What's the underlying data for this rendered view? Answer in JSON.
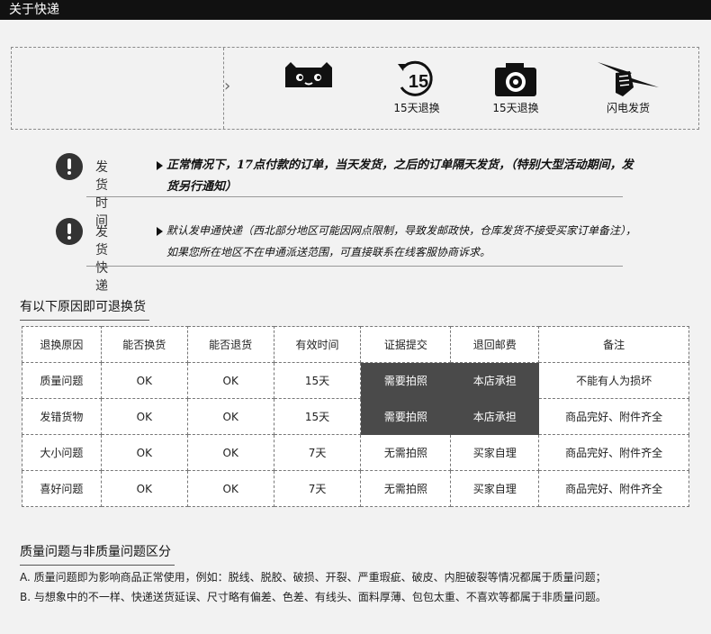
{
  "header": {
    "title": "关于快递"
  },
  "badges": [
    {
      "icon": "tmall-cat-icon",
      "label": ""
    },
    {
      "icon": "fifteen-day-return-icon",
      "label": "15天退换"
    },
    {
      "icon": "camera-icon",
      "label": "15天退换"
    },
    {
      "icon": "lightning-fist-icon",
      "label": "闪电发货"
    }
  ],
  "shipping_time": {
    "label": "发货时间",
    "line1": "正常情况下，17点付款的订单，当天发货，之后的订单隔天发货，（特别大型活动期间，发",
    "line2": "货另行通知）"
  },
  "shipping_courier": {
    "label": "发货快递",
    "line1": "默认发申通快递（西北部分地区可能因网点限制，导致发邮政快，仓库发货不接受买家订单备注），",
    "line2": "如果您所在地区不在申通派送范围，可直接联系在线客服协商诉求。"
  },
  "return_section": {
    "title": "有以下原因即可退换货",
    "headers": [
      "退换原因",
      "能否换货",
      "能否退货",
      "有效时间",
      "证据提交",
      "退回邮费",
      "备注"
    ],
    "rows": [
      [
        "质量问题",
        "OK",
        "OK",
        "15天",
        "需要拍照",
        "本店承担",
        "不能有人为损坏"
      ],
      [
        "发错货物",
        "OK",
        "OK",
        "15天",
        "需要拍照",
        "本店承担",
        "商品完好、附件齐全"
      ],
      [
        "大小问题",
        "OK",
        "OK",
        "7天",
        "无需拍照",
        "买家自理",
        "商品完好、附件齐全"
      ],
      [
        "喜好问题",
        "OK",
        "OK",
        "7天",
        "无需拍照",
        "买家自理",
        "商品完好、附件齐全"
      ]
    ]
  },
  "quality_section": {
    "title": "质量问题与非质量问题区分",
    "line_a": "A. 质量问题即为影响商品正常使用，例如：脱线、脱胶、破损、开裂、严重瑕疵、破皮、内胆破裂等情况都属于质量问题；",
    "line_b": "B. 与想象中的不一样、快递送货延误、尺寸略有偏差、色差、有线头、面料厚薄、包包太重、不喜欢等都属于非质量问题。"
  },
  "colors": {
    "topbar": "#111111",
    "highlight_cell": "#4a4a4a",
    "background": "#f2f2f2"
  }
}
